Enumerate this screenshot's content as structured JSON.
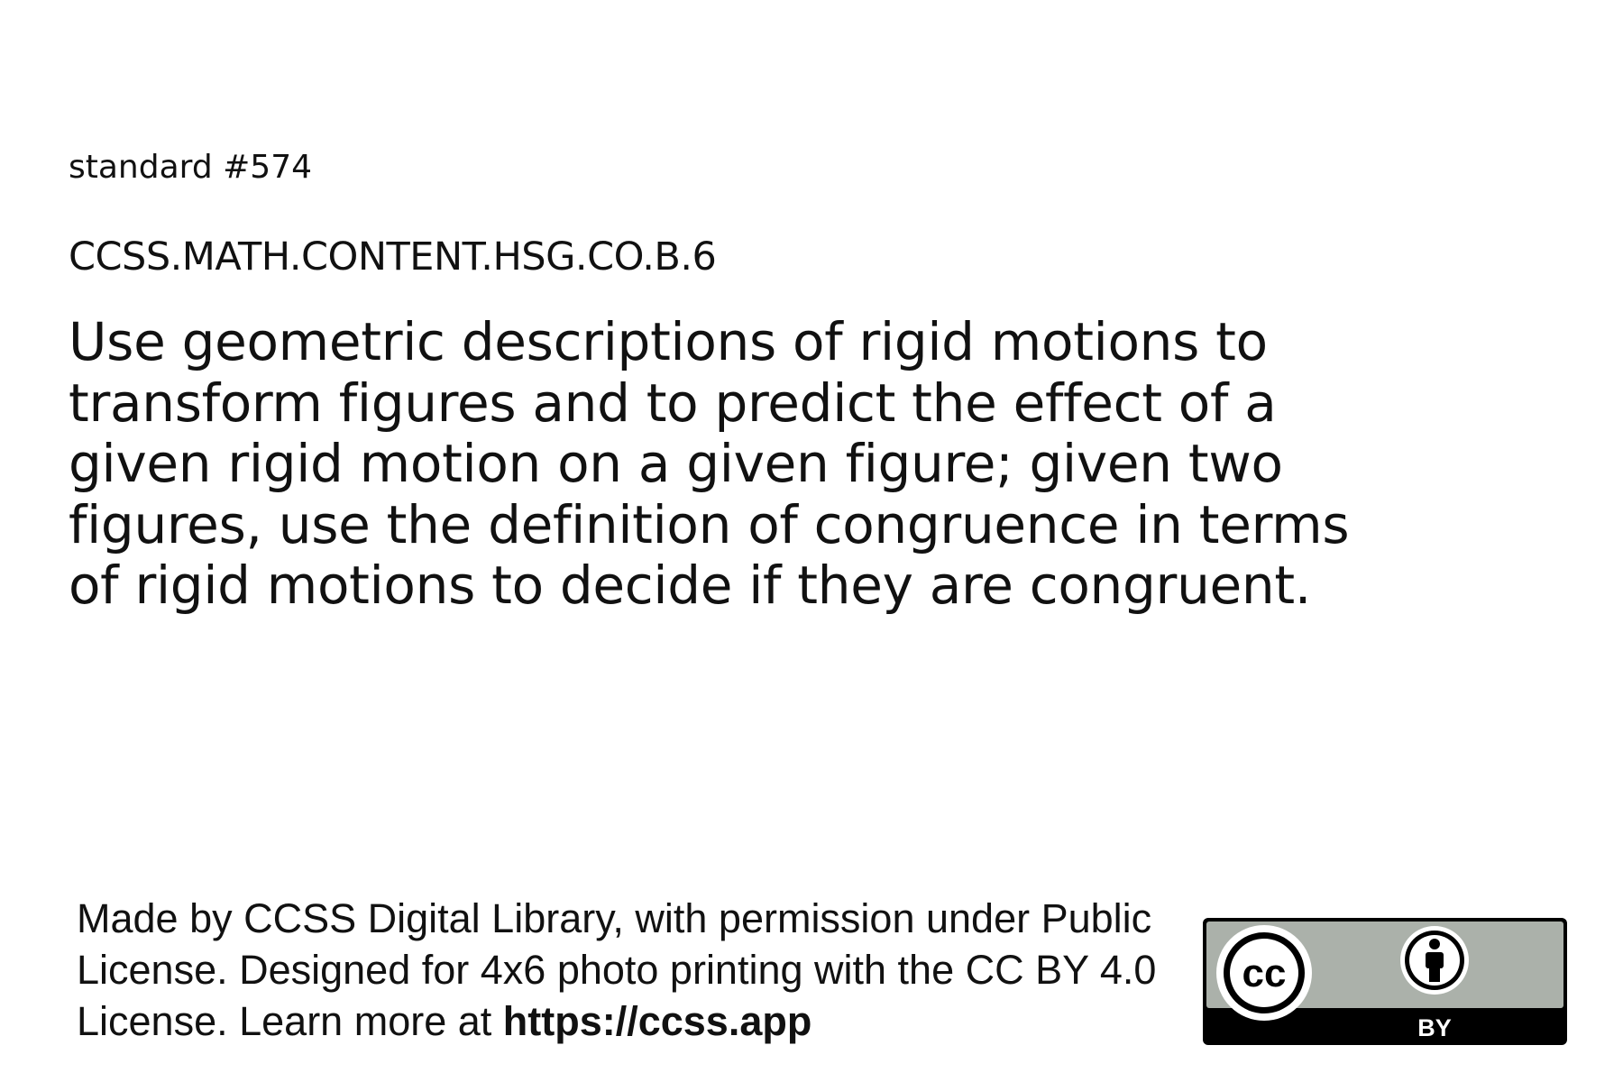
{
  "card": {
    "standard_number": "standard #574",
    "code": "CCSS.MATH.CONTENT.HSG.CO.B.6",
    "text": "Use geometric descriptions of rigid motions to transform figures and to predict the effect of a given rigid motion on a given figure; given two figures, use the definition of congruence in terms of rigid motions to decide if they are congruent."
  },
  "footer": {
    "text": "Made by CCSS Digital Library, with permission under Public License. Designed for 4x6 photo printing with the CC BY 4.0 License. Learn more at ",
    "url": "https://ccss.app"
  },
  "license_badge": {
    "cc_label": "cc",
    "by_label": "BY",
    "colors": {
      "gray": "#abb1aa",
      "black": "#000000",
      "white": "#ffffff"
    },
    "icon": "creative-commons-by-icon"
  }
}
